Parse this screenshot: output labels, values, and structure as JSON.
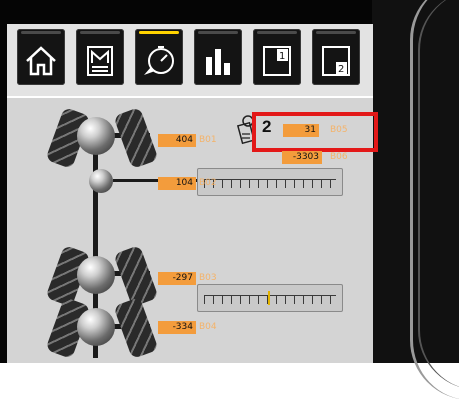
{
  "toolbar": {
    "buttons": [
      {
        "icon": "home-icon"
      },
      {
        "icon": "menu-m-icon"
      },
      {
        "icon": "gauge-icon",
        "active": true
      },
      {
        "icon": "bar-chart-icon"
      },
      {
        "icon": "window-1-icon",
        "label": "1"
      },
      {
        "icon": "window-2-icon",
        "label": "2"
      }
    ]
  },
  "readouts": {
    "front_axle": {
      "value": "404",
      "code": "B01"
    },
    "callout_number": "2",
    "sensor": {
      "value": "31",
      "code": "B05"
    },
    "sensor2": {
      "value": "-3303",
      "code": "B06"
    },
    "middle": {
      "value": "104",
      "code": "B02"
    },
    "rear_axle1": {
      "value": "-297",
      "code": "B03"
    },
    "rear_axle2": {
      "value": "-334",
      "code": "B04"
    }
  },
  "colors": {
    "value_bg": "#f39c3c",
    "code_text": "#f4b36a",
    "highlight": "#e31818",
    "active_led": "#ffd300"
  }
}
